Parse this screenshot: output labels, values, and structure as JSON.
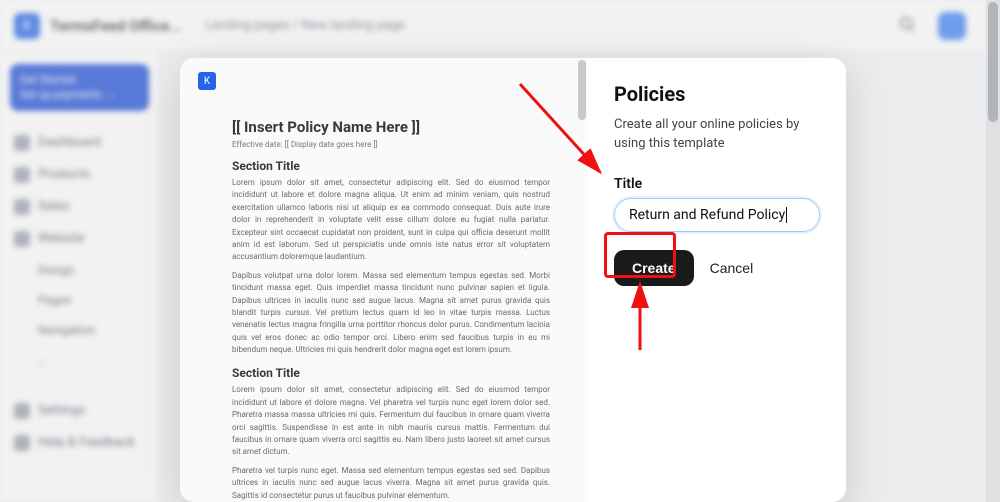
{
  "app": {
    "title": "TermsFeed Office..."
  },
  "breadcrumb": {
    "a": "Landing pages",
    "sep": "/",
    "b": "New landing page"
  },
  "sidebar": {
    "get_started_title": "Get Started",
    "get_started_sub": "Set up payments →",
    "items": [
      {
        "label": "Dashboard"
      },
      {
        "label": "Products"
      },
      {
        "label": "Sales"
      },
      {
        "label": "Website"
      }
    ],
    "sub_items": [
      {
        "label": "Design"
      },
      {
        "label": "Pages"
      },
      {
        "label": "Navigation"
      },
      {
        "label": "…"
      }
    ],
    "footer_items": [
      {
        "label": "Settings"
      },
      {
        "label": "Help & Feedback"
      }
    ]
  },
  "modal": {
    "doc": {
      "title": "[[ Insert Policy Name Here ]]",
      "effective": "Effective date: [[ Display date goes here ]]",
      "section_heading": "Section Title",
      "p1": "Lorem ipsum dolor sit amet, consectetur adipiscing elit. Sed do eiusmod tempor incididunt ut labore et dolore magna aliqua. Ut enim ad minim veniam, quis nostrud exercitation ullamco laboris nisi ut aliquip ex ea commodo consequat. Duis aute irure dolor in reprehenderit in voluptate velit esse cillum dolore eu fugiat nulla pariatur. Excepteur sint occaecat cupidatat non proident, sunt in culpa qui officia deserunt mollit anim id est laborum. Sed ut perspiciatis unde omnis iste natus error sit voluptatem accusantium doloremque laudantium.",
      "p2": "Dapibus volutpat urna dolor lorem. Massa sed elementum tempus egestas sed. Morbi tincidunt massa eget. Quis imperdiet massa tincidunt nunc pulvinar sapien et ligula. Dapibus ultrices in iaculis nunc sed augue lacus. Magna sit amet purus gravida quis blandit turpis cursus. Vel pretium lectus quam id leo in vitae turpis massa. Luctus venenatis lectus magna fringilla urna porttitor rhoncus dolor purus. Condimentum lacinia quis vel eros donec ac odio tempor orci. Libero enim sed faucibus turpis in eu mi bibendum neque. Ultricies mi quis hendrerit dolor magna eget est lorem ipsum.",
      "p3": "Lorem ipsum dolor sit amet, consectetur adipiscing elit. Sed do eiusmod tempor incididunt ut labore et dolore magna. Vel pharetra vel turpis nunc eget lorem dolor sed. Pharetra massa massa ultricies mi quis. Fermentum dui faucibus in ornare quam viverra orci sagittis. Suspendisse in est ante in nibh mauris cursus mattis. Fermentum dui faucibus in ornare quam viverra orci sagittis eu. Nam libero justo laoreet sit amet cursus sit amet dictum.",
      "p4": "Pharetra vel turpis nunc eget. Massa sed elementum tempus egestas sed sed. Dapibus ultrices in iaculis nunc sed augue lacus viverra. Magna sit amet purus gravida quis. Sagittis id consectetur purus ut faucibus pulvinar elementum."
    },
    "heading": "Policies",
    "description": "Create all your online policies by using this template",
    "title_label": "Title",
    "title_value": "Return and Refund Policy",
    "create_label": "Create",
    "cancel_label": "Cancel"
  }
}
